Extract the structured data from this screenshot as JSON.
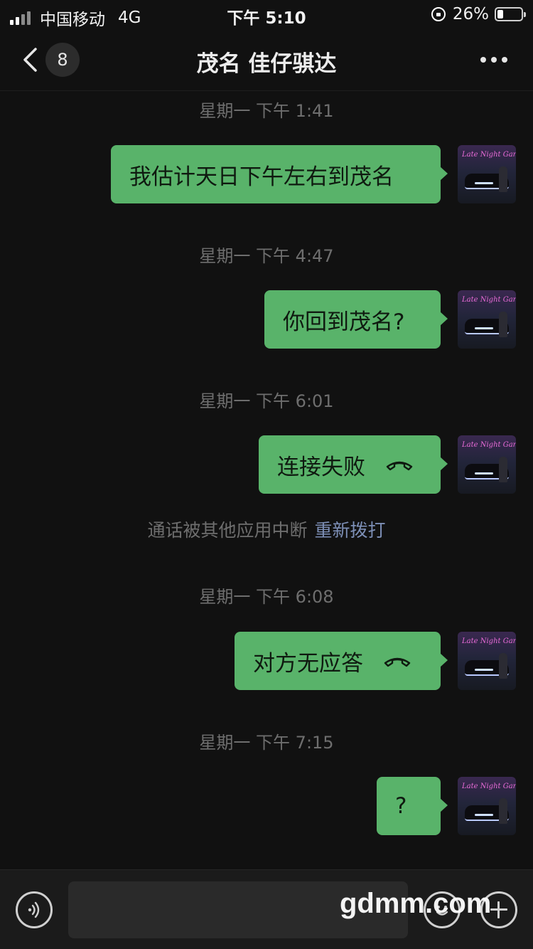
{
  "status_bar": {
    "carrier": "中国移动",
    "network": "4G",
    "time": "下午 5:10",
    "battery_percent": "26%",
    "icons": [
      "signal-icon",
      "rotation-lock-icon",
      "battery-icon"
    ]
  },
  "nav": {
    "back_icon": "chevron-left-icon",
    "unread_count": "8",
    "title": "茂名 佳仔骐达",
    "more_icon": "more-dots-icon"
  },
  "messages": [
    {
      "timestamp": "星期一 下午 1:41",
      "text": "我估计天日下午左右到茂名",
      "call_icon": false
    },
    {
      "timestamp": "星期一 下午 4:47",
      "text": "你回到茂名?",
      "call_icon": false
    },
    {
      "timestamp": "星期一 下午 6:01",
      "text": "连接失败",
      "call_icon": true
    },
    {
      "timestamp": "星期一 下午 6:08",
      "text": "对方无应答",
      "call_icon": true
    },
    {
      "timestamp": "星期一 下午 7:15",
      "text": "?",
      "call_icon": false
    }
  ],
  "system_note": {
    "text": "通话被其他应用中断",
    "link": "重新拨打"
  },
  "avatar": {
    "neon_text": "Late Night Garage"
  },
  "input_bar": {
    "voice_icon": "voice-icon",
    "emoji_icon": "emoji-icon",
    "plus_icon": "plus-icon"
  },
  "watermark": "gdmm.com",
  "colors": {
    "background": "#111111",
    "bubble": "#59b36a",
    "timestamp": "#6e6e6e",
    "link": "#7d8fb6"
  }
}
